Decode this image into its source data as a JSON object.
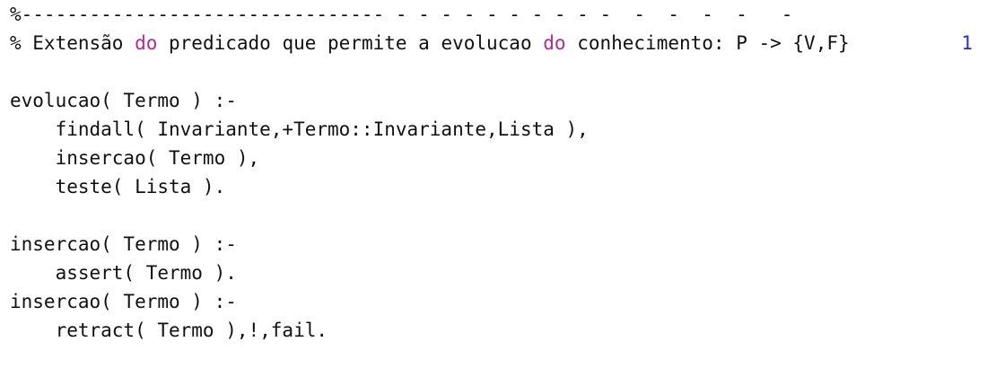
{
  "editor": {
    "line_number": "1",
    "lines": {
      "l0": "%-------------------------------- - - - - - - - - - -  -  -  -  -   -",
      "l1": {
        "a": "% Extensão ",
        "kw1": "do",
        "b": " predicado que permite a evolucao ",
        "kw2": "do",
        "c": " conhecimento: P -> {V,F}"
      },
      "l3": "evolucao( Termo ) :-",
      "l4": "    findall( Invariante,+Termo::Invariante,Lista ),",
      "l5": "    insercao( Termo ),",
      "l6": "    teste( Lista ).",
      "l8": "insercao( Termo ) :-",
      "l9": "    assert( Termo ).",
      "l10": "insercao( Termo ) :-",
      "l11": "    retract( Termo ),!,fail."
    },
    "colors": {
      "text": "#111111",
      "keyword": "#b3289a",
      "line_number": "#2432b8",
      "background": "#ffffff"
    }
  }
}
